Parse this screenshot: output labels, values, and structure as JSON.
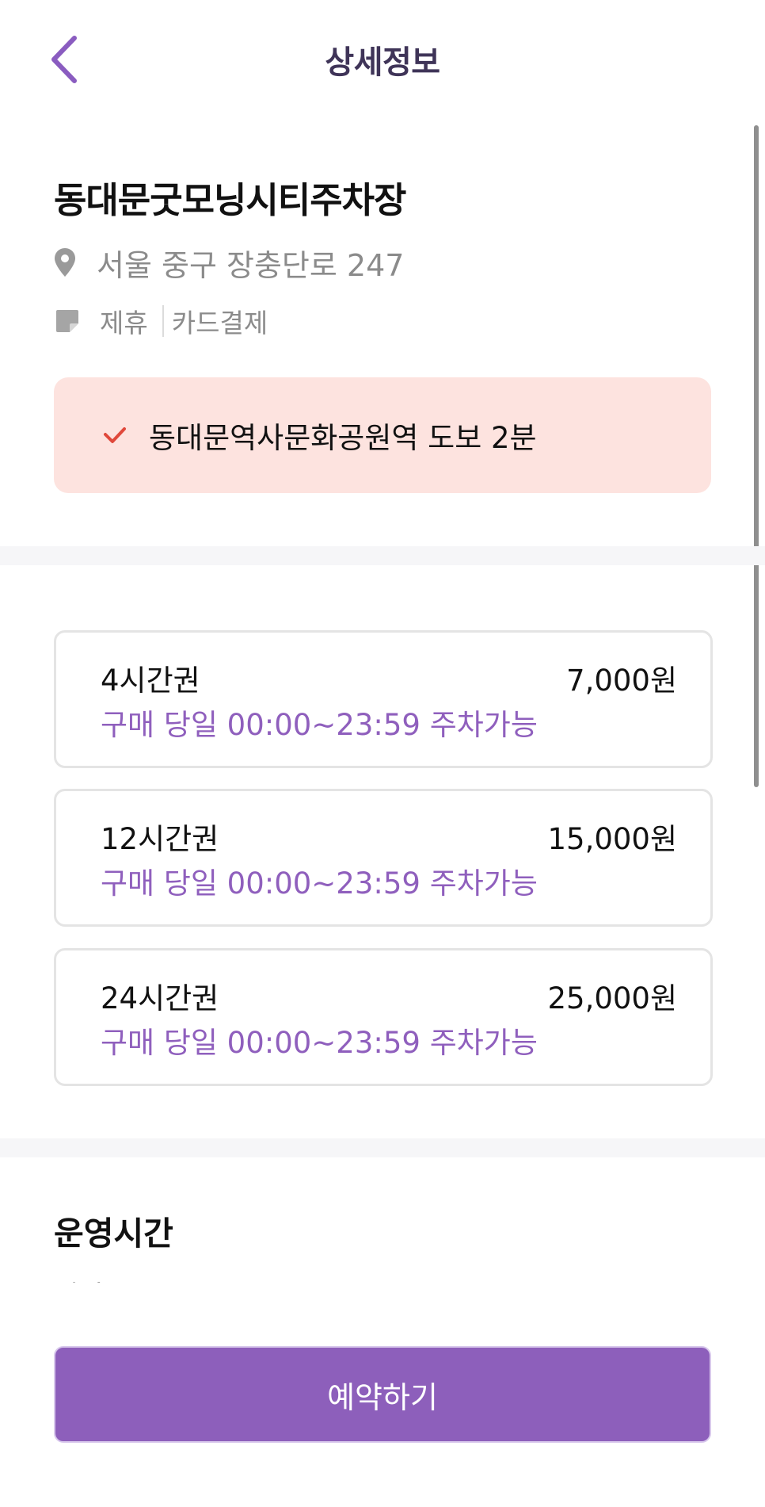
{
  "header": {
    "title": "상세정보",
    "back_icon": "chevron-left-icon"
  },
  "lot": {
    "name": "동대문굿모닝시티주차장",
    "address": "서울 중구 장충단로 247",
    "tags": [
      "제휴",
      "카드결제"
    ],
    "notice": "동대문역사문화공원역 도보 2분"
  },
  "tickets": [
    {
      "name": "4시간권",
      "price": "7,000원",
      "desc": "구매 당일 00:00~23:59 주차가능"
    },
    {
      "name": "12시간권",
      "price": "15,000원",
      "desc": "구매 당일 00:00~23:59 주차가능"
    },
    {
      "name": "24시간권",
      "price": "25,000원",
      "desc": "구매 당일 00:00~23:59 주차가능"
    }
  ],
  "hours": {
    "title": "운영시간",
    "peek": "평일"
  },
  "cta": {
    "label": "예약하기"
  },
  "colors": {
    "accent": "#8d5fbb",
    "notice_bg": "#fde3df",
    "check": "#e0483b",
    "muted": "#8b8b8b"
  }
}
